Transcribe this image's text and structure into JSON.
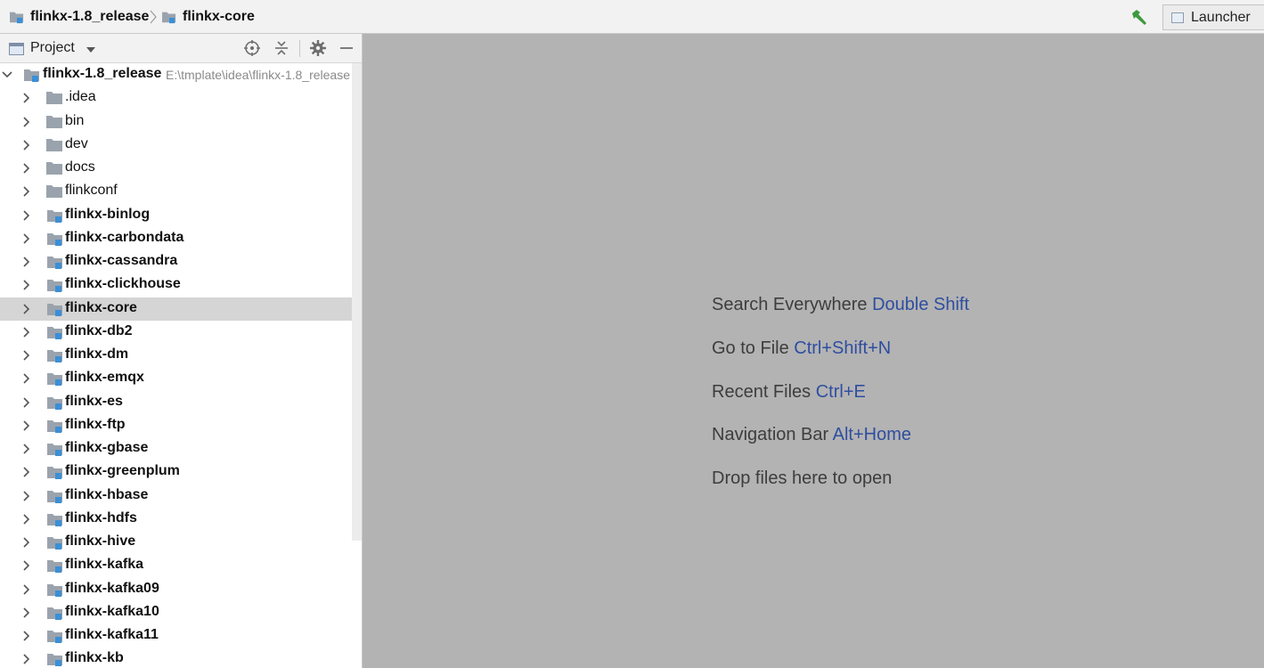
{
  "navbar": {
    "crumbs": [
      "flinkx-1.8_release",
      "flinkx-core"
    ],
    "run_config": "Launcher",
    "colors": {
      "build_icon": "#3d9a3d"
    }
  },
  "panel": {
    "title": "Project",
    "tools": [
      "target-icon",
      "collapse-all-icon",
      "gear-icon",
      "minimize-icon"
    ]
  },
  "tree": {
    "root": {
      "name": "flinkx-1.8_release",
      "path": "E:\\tmplate\\idea\\flinkx-1.8_release"
    },
    "items": [
      {
        "name": ".idea",
        "module": false
      },
      {
        "name": "bin",
        "module": false
      },
      {
        "name": "dev",
        "module": false
      },
      {
        "name": "docs",
        "module": false
      },
      {
        "name": "flinkconf",
        "module": false
      },
      {
        "name": "flinkx-binlog",
        "module": true
      },
      {
        "name": "flinkx-carbondata",
        "module": true
      },
      {
        "name": "flinkx-cassandra",
        "module": true
      },
      {
        "name": "flinkx-clickhouse",
        "module": true
      },
      {
        "name": "flinkx-core",
        "module": true,
        "selected": true
      },
      {
        "name": "flinkx-db2",
        "module": true
      },
      {
        "name": "flinkx-dm",
        "module": true
      },
      {
        "name": "flinkx-emqx",
        "module": true
      },
      {
        "name": "flinkx-es",
        "module": true
      },
      {
        "name": "flinkx-ftp",
        "module": true
      },
      {
        "name": "flinkx-gbase",
        "module": true
      },
      {
        "name": "flinkx-greenplum",
        "module": true
      },
      {
        "name": "flinkx-hbase",
        "module": true
      },
      {
        "name": "flinkx-hdfs",
        "module": true
      },
      {
        "name": "flinkx-hive",
        "module": true
      },
      {
        "name": "flinkx-kafka",
        "module": true
      },
      {
        "name": "flinkx-kafka09",
        "module": true
      },
      {
        "name": "flinkx-kafka10",
        "module": true
      },
      {
        "name": "flinkx-kafka11",
        "module": true
      },
      {
        "name": "flinkx-kb",
        "module": true
      }
    ]
  },
  "editor": {
    "hints": [
      {
        "label": "Search Everywhere",
        "shortcut": "Double Shift"
      },
      {
        "label": "Go to File",
        "shortcut": "Ctrl+Shift+N"
      },
      {
        "label": "Recent Files",
        "shortcut": "Ctrl+E"
      },
      {
        "label": "Navigation Bar",
        "shortcut": "Alt+Home"
      },
      {
        "label": "Drop files here to open",
        "shortcut": ""
      }
    ],
    "colors": {
      "background": "#b3b3b3",
      "shortcut": "#2f4ea0"
    }
  }
}
